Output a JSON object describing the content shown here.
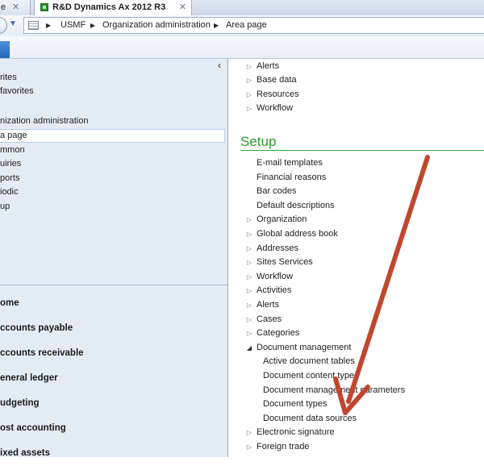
{
  "tabs": {
    "previous": {
      "label": "e",
      "close": "✕"
    },
    "active": {
      "label": "R&D Dynamics Ax 2012 R3",
      "close": "✕"
    }
  },
  "address": {
    "breadcrumbs": [
      "USMF",
      "Organization administration",
      "Area page"
    ],
    "separator": "▶"
  },
  "navigation": {
    "collapse_glyph": "‹",
    "items": [
      {
        "label": "rites"
      },
      {
        "label": "favorites"
      },
      {
        "label": "nization administration"
      },
      {
        "label": "a page"
      },
      {
        "label": "mmon"
      },
      {
        "label": "uiries"
      },
      {
        "label": "ports"
      },
      {
        "label": "iodic"
      },
      {
        "label": "up"
      }
    ],
    "modules": [
      {
        "label": "ome"
      },
      {
        "label": "ccounts payable"
      },
      {
        "label": "ccounts receivable"
      },
      {
        "label": "eneral ledger"
      },
      {
        "label": "udgeting"
      },
      {
        "label": "ost accounting"
      },
      {
        "label": "ixed assets"
      }
    ]
  },
  "content": {
    "top_items": [
      {
        "label": "Alerts",
        "expandable": true
      },
      {
        "label": "Base data",
        "expandable": true
      },
      {
        "label": "Resources",
        "expandable": true
      },
      {
        "label": "Workflow",
        "expandable": true
      }
    ],
    "setup": {
      "heading": "Setup",
      "items": [
        {
          "label": "E-mail templates",
          "expander": "none"
        },
        {
          "label": "Financial reasons",
          "expander": "none"
        },
        {
          "label": "Bar codes",
          "expander": "none"
        },
        {
          "label": "Default descriptions",
          "expander": "none"
        },
        {
          "label": "Organization",
          "expander": "collapsed"
        },
        {
          "label": "Global address book",
          "expander": "collapsed"
        },
        {
          "label": "Addresses",
          "expander": "collapsed"
        },
        {
          "label": "Sites Services",
          "expander": "collapsed"
        },
        {
          "label": "Workflow",
          "expander": "collapsed"
        },
        {
          "label": "Activities",
          "expander": "collapsed"
        },
        {
          "label": "Alerts",
          "expander": "collapsed"
        },
        {
          "label": "Cases",
          "expander": "collapsed"
        },
        {
          "label": "Categories",
          "expander": "collapsed"
        },
        {
          "label": "Document management",
          "expander": "expanded"
        },
        {
          "label": "Active document tables",
          "expander": "child"
        },
        {
          "label": "Document content types",
          "expander": "child"
        },
        {
          "label": "Document management parameters",
          "expander": "child"
        },
        {
          "label": "Document types",
          "expander": "child"
        },
        {
          "label": "Document data sources",
          "expander": "child"
        },
        {
          "label": "Electronic signature",
          "expander": "collapsed"
        },
        {
          "label": "Foreign trade",
          "expander": "collapsed"
        }
      ]
    }
  },
  "icons": {
    "collapsed": "▷",
    "expanded": "◢",
    "dropdown": "▼"
  },
  "colors": {
    "setup_heading": "#2f9a2f",
    "arrow": "#c0472f"
  }
}
